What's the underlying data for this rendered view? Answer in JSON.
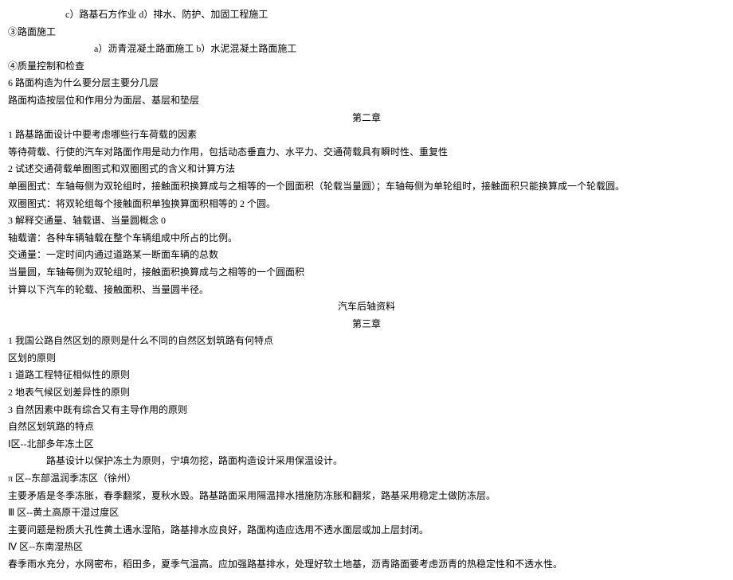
{
  "lines": {
    "l1": "c）路基石方作业 d）排水、防护、加固工程施工",
    "l2": "③路面施工",
    "l3": "a）沥青混凝土路面施工 b）水泥混凝土路面施工",
    "l4": "④质量控制和检查",
    "l5": "6 路面构造为什么要分层主要分几层",
    "l6": "路面构造按层位和作用分为面层、基层和垫层",
    "l7": "第二章",
    "l8": "1 路基路面设计中要考虑哪些行车荷载的因素",
    "l9": "等待荷载、行使的汽车对路面作用是动力作用，包括动态垂直力、水平力、交通荷载具有瞬时性、重复性",
    "l10": "2 试述交通荷载单圈图式和双圈图式的含义和计算方法",
    "l11": "单圈图式：车轴每侧为双轮组时，接触面积换算成与之相等的一个圆面积（轮载当量圆）；车轴每侧为单轮组时，接触面积只能换算成一个轮载圆。",
    "l12": "双圈图式：将双轮组每个接触面积单独换算面积相等的 2 个圆。",
    "l13": "3 解释交通量、轴载谱、当量圆概念 0",
    "l14": "轴载谱：各种车辆轴载在整个车辆组成中所占的比例。",
    "l15": "交通量：一定时间内通过道路某一断面车辆的总数",
    "l16": "当量圆，车轴每侧为双轮组时，接触面积换算成与之相等的一个圆面积",
    "l17": "计算以下汽车的轮载、接触面积、当量圆半径。",
    "l18": "汽车后轴资料",
    "l19": "第三章",
    "l20": "1 我国公路自然区划的原则是什么不同的自然区划筑路有何特点",
    "l21": "区划的原则",
    "l22": "1 道路工程特征相似性的原则",
    "l23": "2 地表气候区划差异性的原则",
    "l24": "3 自然因素中既有综合又有主导作用的原则",
    "l25": "自然区划筑路的特点",
    "l26": "Ⅰ区--北部多年冻土区",
    "l27": "路基设计以保护冻土为原则，宁填勿挖，路面构造设计采用保温设计。",
    "l28": "π 区--东部温润季冻区（徐州）",
    "l29": "主要矛盾是冬季冻胀，春季翻浆，夏秋水毁。路基路面采用隔温排水措施防冻胀和翻浆，路基采用稳定土做防冻层。",
    "l30": "Ⅲ 区--黄土高原干湿过度区",
    "l31": "主要问题是粉质大孔性黄土遇水湿陷，路基排水应良好，路面构造应选用不透水面层或加上层封闭。",
    "l32": "Ⅳ 区--东南湿热区",
    "l33": "春季雨水充分，水网密布，稻田多，夏季气温高。应加强路基排水，处理好软土地基，沥青路面要考虑沥青的热稳定性和不透水性。"
  }
}
